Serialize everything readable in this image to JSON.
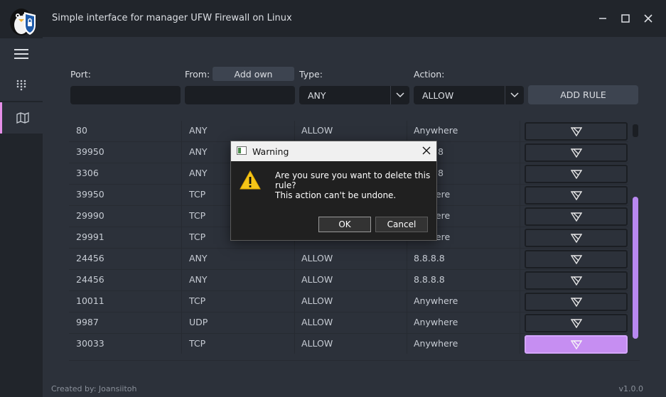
{
  "app": {
    "title": "Simple interface for manager UFW Firewall on Linux",
    "version": "v1.0.0",
    "credit": "Created by: Joansiitoh"
  },
  "window_controls": [
    "minimize",
    "maximize",
    "close"
  ],
  "sidebar": {
    "items": [
      {
        "icon": "hamburger-menu-icon"
      },
      {
        "icon": "dialpad-icon"
      },
      {
        "icon": "map-icon",
        "selected": true
      }
    ]
  },
  "form": {
    "port_label": "Port:",
    "from_label": "From:",
    "add_own_label": "Add own",
    "type_label": "Type:",
    "action_label": "Action:",
    "type_value": "ANY",
    "action_value": "ALLOW",
    "add_rule_label": "ADD RULE"
  },
  "rules": [
    {
      "port": "80",
      "type": "ANY",
      "action": "ALLOW",
      "from": "Anywhere"
    },
    {
      "port": "39950",
      "type": "ANY",
      "action": "",
      "from": ".8"
    },
    {
      "port": "3306",
      "type": "ANY",
      "action": "",
      "from": ".8"
    },
    {
      "port": "39950",
      "type": "TCP",
      "action": "",
      "from": "here"
    },
    {
      "port": "29990",
      "type": "TCP",
      "action": "",
      "from": "here"
    },
    {
      "port": "29991",
      "type": "TCP",
      "action": "",
      "from": "here"
    },
    {
      "port": "24456",
      "type": "ANY",
      "action": "ALLOW",
      "from": "8.8.8.8"
    },
    {
      "port": "24456",
      "type": "ANY",
      "action": "ALLOW",
      "from": "8.8.8.8"
    },
    {
      "port": "10011",
      "type": "TCP",
      "action": "ALLOW",
      "from": "Anywhere"
    },
    {
      "port": "9987",
      "type": "UDP",
      "action": "ALLOW",
      "from": "Anywhere"
    },
    {
      "port": "30033",
      "type": "TCP",
      "action": "ALLOW",
      "from": "Anywhere"
    }
  ],
  "dialog": {
    "title": "Warning",
    "message": "Are you sure you want to delete this rule?",
    "detail": "This action can't be undone.",
    "ok_label": "OK",
    "cancel_label": "Cancel"
  },
  "colors": {
    "accent": "#c68ef2",
    "background": "#2c313a",
    "sidebar": "#21252b"
  }
}
